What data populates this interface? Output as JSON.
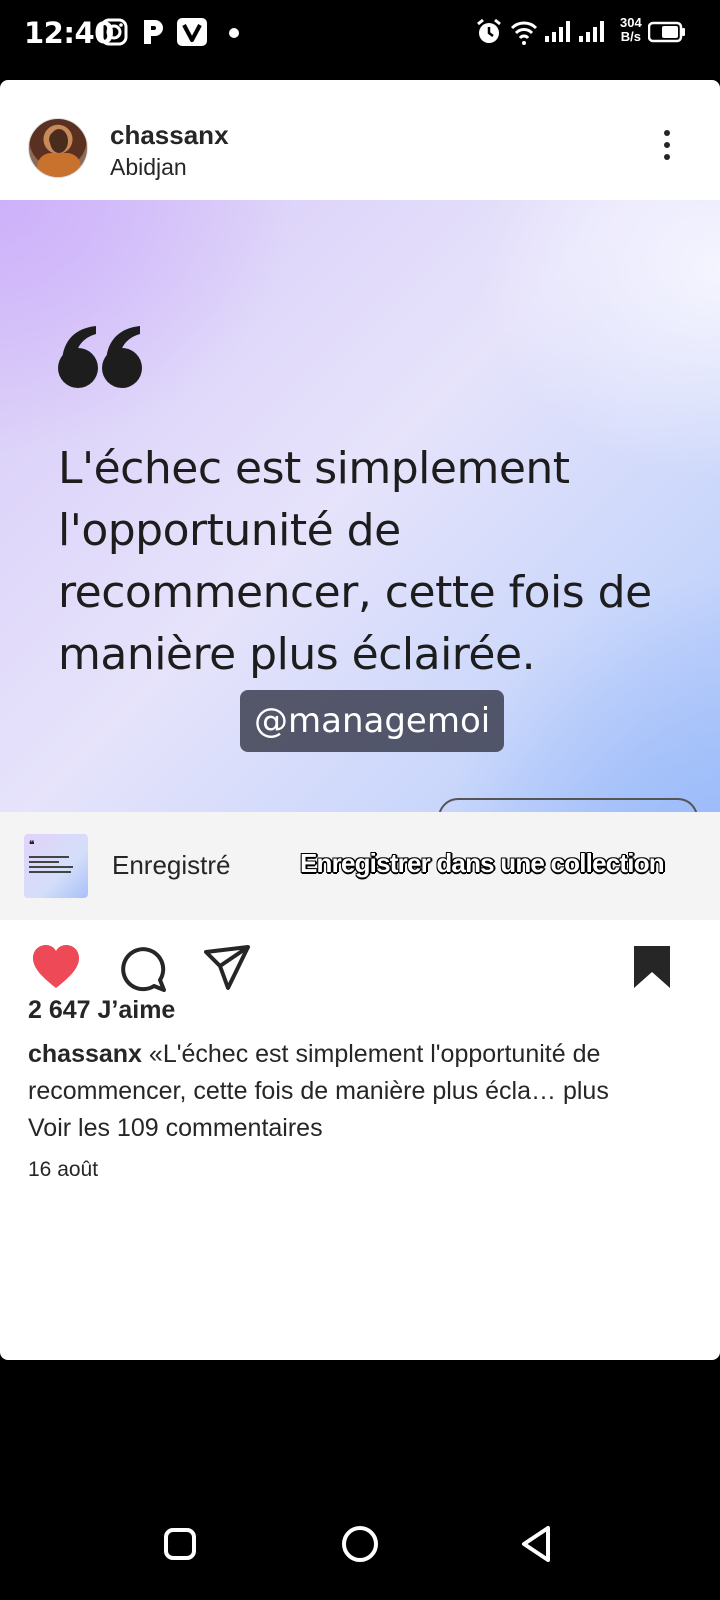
{
  "status_bar": {
    "time": "12:40",
    "net_speed_value": "304",
    "net_speed_unit": "B/s",
    "icons": [
      "instagram-icon",
      "p-app-icon",
      "v-app-icon",
      "alarm-icon",
      "wifi-icon",
      "signal-icon",
      "signal-icon",
      "battery-icon"
    ]
  },
  "post": {
    "username": "chassanx",
    "location": "Abidjan",
    "image": {
      "quote_text": "L'échec est simplement l'opportunité de recommencer, cette fois de manière plus éclairée.",
      "watermark": "@managemoi"
    },
    "saved_bar": {
      "label": "Enregistré",
      "collection_link": "Enregistrer dans une collection"
    },
    "likes": "2 647 J’aime",
    "caption_user": "chassanx",
    "caption_text": " «L'échec est simplement l'opportunité de recommencer, cette fois de manière plus écla… ",
    "caption_more": "plus",
    "comments_link": "Voir les 109 commentaires",
    "date": "16 août"
  },
  "colors": {
    "like_active": "#ED4956",
    "text": "#262626",
    "saved_bar_bg": "#F4F4F4"
  }
}
